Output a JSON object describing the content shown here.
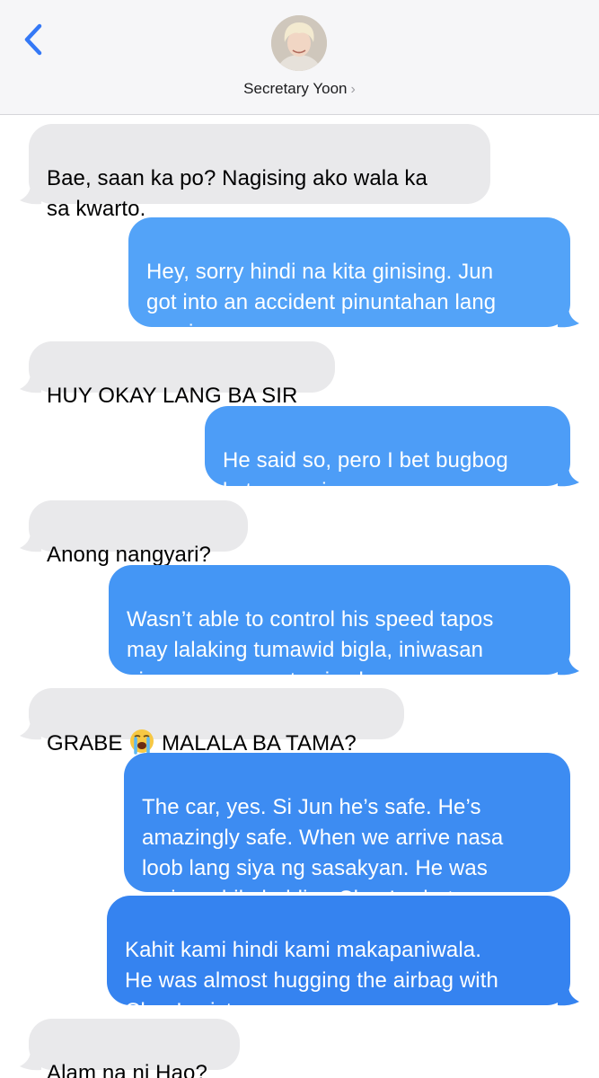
{
  "header": {
    "contact_name": "Secretary Yoon",
    "chevron": "›",
    "back_icon": "chevron-left-icon",
    "accent_color": "#3478f6"
  },
  "messages": [
    {
      "from": "contact",
      "text": "Bae, saan ka po? Nagising ako wala ka\nsa kwarto."
    },
    {
      "from": "me",
      "text": "Hey, sorry hindi na kita ginising. Jun\ngot into an accident pinuntahan lang\nnamin."
    },
    {
      "from": "contact",
      "text": "HUY OKAY LANG BA SIR"
    },
    {
      "from": "me",
      "text": "He said so, pero I bet bugbog\nkatawan niya."
    },
    {
      "from": "contact",
      "text": "Anong nangyari?"
    },
    {
      "from": "me",
      "text": "Wasn’t able to control his speed tapos\nmay lalaking tumawid bigla, iniwasan\nniya ayun sa poste siya bumangga."
    },
    {
      "from": "contact",
      "text_before": "GRABE ",
      "emoji": "😭",
      "text_after": " MALALA BA TAMA?"
    },
    {
      "from": "me",
      "text": "The car, yes. Si Jun he’s safe. He’s\namazingly safe. When we arrive nasa\nloob lang siya ng sasakyan. He was\ncrying while holding Chen’s photo."
    },
    {
      "from": "me",
      "text": "Kahit kami hindi kami makapaniwala.\nHe was almost hugging the airbag with\nChen’s picture."
    },
    {
      "from": "contact",
      "text": "Alam na ni Hao?"
    }
  ],
  "colors": {
    "received_bubble": "#e9e9eb",
    "sent_bubble": "#3e8ef0",
    "header_bg": "#f6f6f8"
  }
}
